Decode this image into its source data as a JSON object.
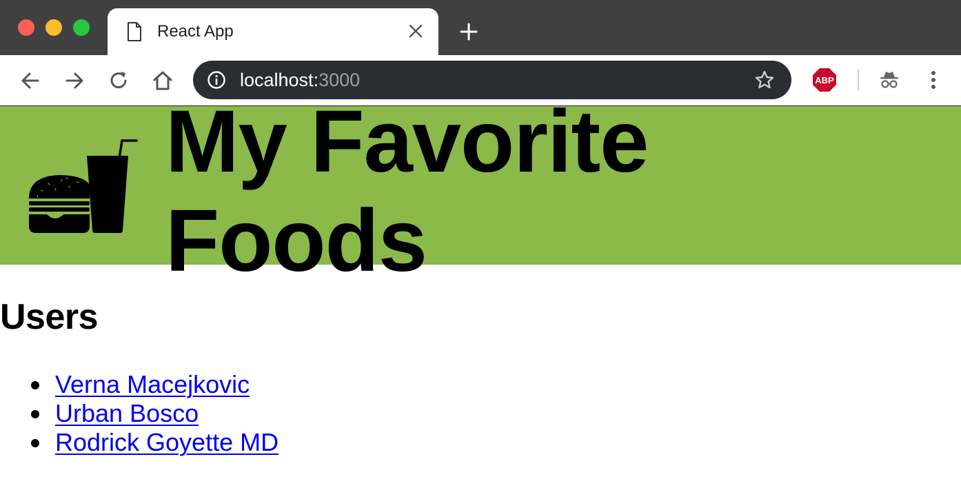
{
  "browser": {
    "tab_title": "React App",
    "url_host": "localhost:",
    "url_port": "3000",
    "extension_badge": "ABP",
    "icons": [
      "document-icon",
      "close-icon",
      "plus-icon",
      "back-arrow-icon",
      "forward-arrow-icon",
      "reload-icon",
      "home-icon",
      "info-icon",
      "star-icon",
      "adblock-icon",
      "incognito-icon",
      "kebab-menu-icon"
    ]
  },
  "header": {
    "title": "My Favorite Foods",
    "background_color": "#8bb94a",
    "logo_icon": "burger-and-drink-icon"
  },
  "main": {
    "heading": "Users",
    "users": [
      {
        "name": "Verna Macejkovic"
      },
      {
        "name": "Urban Bosco"
      },
      {
        "name": "Rodrick Goyette MD"
      }
    ],
    "link_color": "#0000ee"
  }
}
